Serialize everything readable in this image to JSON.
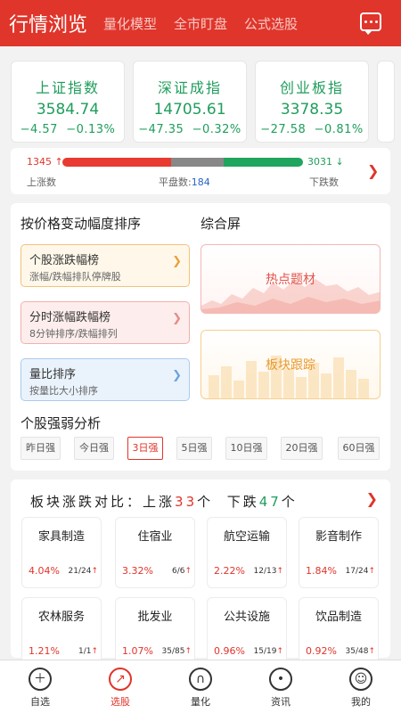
{
  "header": {
    "title": "行情浏览",
    "tabs": [
      "量化模型",
      "全市盯盘",
      "公式选股"
    ],
    "message_icon": "message-icon"
  },
  "indices": [
    {
      "name": "上证指数",
      "value": "3584.74",
      "change": "−4.57",
      "pct": "−0.13%"
    },
    {
      "name": "深证成指",
      "value": "14705.61",
      "change": "−47.35",
      "pct": "−0.32%"
    },
    {
      "name": "创业板指",
      "value": "3378.35",
      "change": "−27.58",
      "pct": "−0.81%"
    }
  ],
  "breadth": {
    "up_count": "1345",
    "down_count": "3031",
    "up_label": "上涨数",
    "flat_label": "平盘数:",
    "flat_count": "184",
    "down_label": "下跌数",
    "up_arrow": "↑",
    "down_arrow": "↓"
  },
  "ranking": {
    "title": "按价格变动幅度排序",
    "items": [
      {
        "title": "个股涨跌幅榜",
        "sub": "涨幅/跌幅排队停牌股"
      },
      {
        "title": "分时涨幅跌幅榜",
        "sub": "8分钟排序/跌幅排列"
      },
      {
        "title": "量比排序",
        "sub": "按量比大小排序"
      }
    ]
  },
  "screen": {
    "title": "综合屏",
    "items": [
      "热点题材",
      "板块跟踪"
    ]
  },
  "strength": {
    "title": "个股强弱分析",
    "tabs": [
      "昨日强",
      "今日强",
      "3日强",
      "5日强",
      "10日强",
      "20日强",
      "60日强"
    ],
    "active": "3日强"
  },
  "sector": {
    "title_prefix": "板块涨跌对比：",
    "up_label": "上涨",
    "up_count": "33",
    "unit": "个",
    "down_label": "下跌",
    "down_count": "47",
    "cards": [
      {
        "name": "家具制造",
        "pct": "4.04%",
        "count": "21/24"
      },
      {
        "name": "住宿业",
        "pct": "3.32%",
        "count": "6/6"
      },
      {
        "name": "航空运输",
        "pct": "2.22%",
        "count": "12/13"
      },
      {
        "name": "影音制作",
        "pct": "1.84%",
        "count": "17/24"
      },
      {
        "name": "农林服务",
        "pct": "1.21%",
        "count": "1/1"
      },
      {
        "name": "批发业",
        "pct": "1.07%",
        "count": "35/85"
      },
      {
        "name": "公共设施",
        "pct": "0.96%",
        "count": "15/19"
      },
      {
        "name": "饮品制造",
        "pct": "0.92%",
        "count": "35/48"
      }
    ]
  },
  "nav": [
    {
      "label": "自选",
      "icon": "plus-circle-icon"
    },
    {
      "label": "选股",
      "icon": "trend-icon"
    },
    {
      "label": "量化",
      "icon": "quant-icon"
    },
    {
      "label": "资讯",
      "icon": "broadcast-icon"
    },
    {
      "label": "我的",
      "icon": "user-icon"
    }
  ],
  "colors": {
    "brand": "#e0352b",
    "up": "#e0352b",
    "down": "#1f9d5c"
  }
}
